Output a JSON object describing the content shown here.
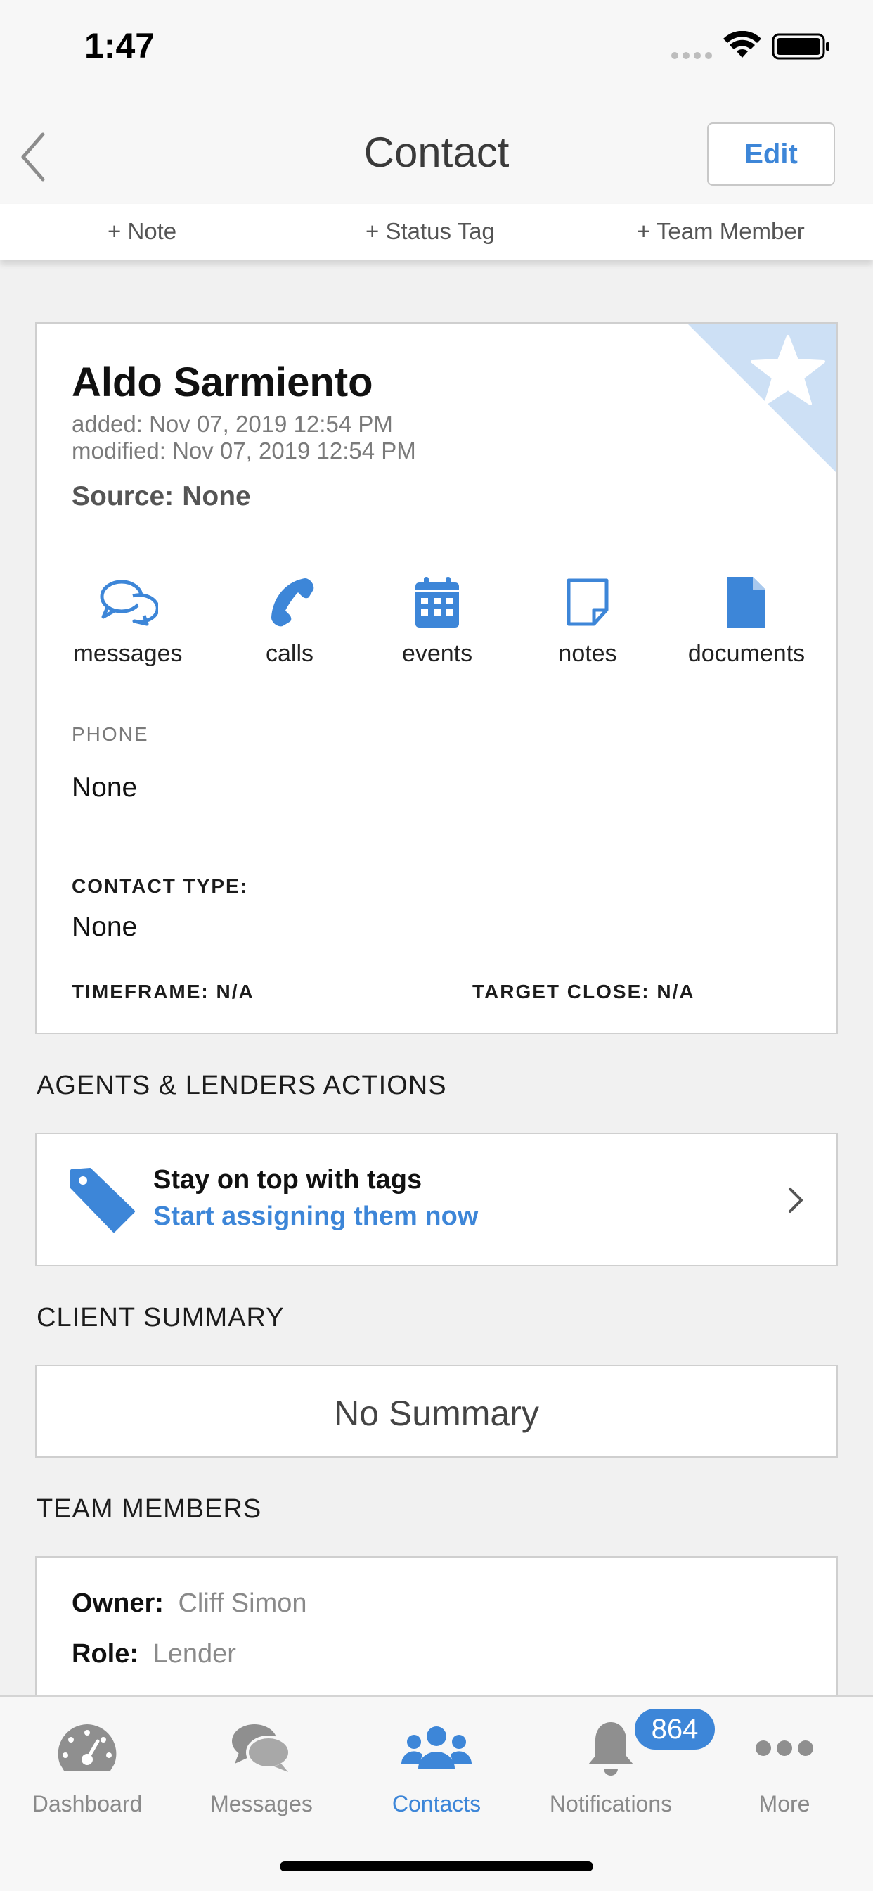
{
  "status_bar": {
    "time": "1:47"
  },
  "nav": {
    "title": "Contact",
    "edit_label": "Edit"
  },
  "quick_actions": {
    "note": "+ Note",
    "status_tag": "+ Status Tag",
    "team_member": "+ Team Member"
  },
  "contact": {
    "name": "Aldo Sarmiento",
    "added": "added: Nov 07, 2019 12:54 PM",
    "modified": "modified: Nov 07, 2019 12:54 PM",
    "source_label": "Source:",
    "source_value": "None",
    "favorite_icon": "star-icon"
  },
  "action_buttons": [
    {
      "label": "messages",
      "icon": "chat-bubbles-icon"
    },
    {
      "label": "calls",
      "icon": "phone-icon"
    },
    {
      "label": "events",
      "icon": "calendar-icon"
    },
    {
      "label": "notes",
      "icon": "note-icon"
    },
    {
      "label": "documents",
      "icon": "document-icon"
    }
  ],
  "phone": {
    "label": "PHONE",
    "value": "None"
  },
  "contact_type": {
    "label": "CONTACT TYPE:",
    "value": "None",
    "timeframe": "TIMEFRAME: N/A",
    "target_close": "TARGET CLOSE: N/A"
  },
  "agents_lenders": {
    "section_title": "AGENTS & LENDERS ACTIONS",
    "title": "Stay on top with tags",
    "link": "Start assigning them now"
  },
  "client_summary": {
    "section_title": "CLIENT SUMMARY",
    "text": "No Summary"
  },
  "team_members": {
    "section_title": "TEAM MEMBERS",
    "owner_label": "Owner:",
    "owner_value": "Cliff Simon",
    "role_label": "Role:",
    "role_value": "Lender"
  },
  "tab_bar": {
    "tabs": [
      {
        "label": "Dashboard",
        "icon": "gauge-icon"
      },
      {
        "label": "Messages",
        "icon": "chat-bubbles-icon"
      },
      {
        "label": "Contacts",
        "icon": "people-icon"
      },
      {
        "label": "Notifications",
        "icon": "bell-icon"
      },
      {
        "label": "More",
        "icon": "more-dots-icon"
      }
    ],
    "active": "Contacts",
    "notification_badge": "864"
  },
  "colors": {
    "accent": "#3d86d8",
    "corner": "#cde0f5",
    "background": "#f1f1f1"
  }
}
